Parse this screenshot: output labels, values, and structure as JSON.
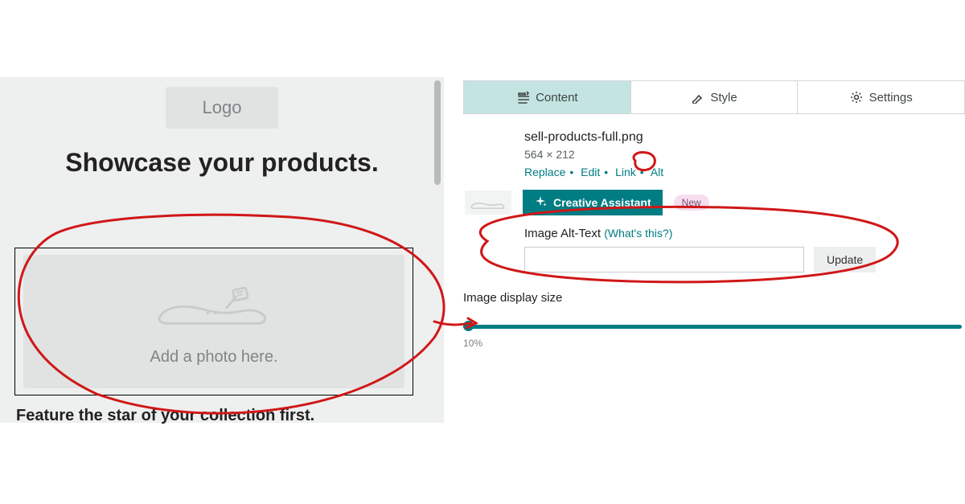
{
  "preview": {
    "logo_label": "Logo",
    "headline": "Showcase your products.",
    "placeholder_text": "Add a photo here.",
    "subheading": "Feature the star of your collection first."
  },
  "tabs": {
    "content": "Content",
    "style": "Style",
    "settings": "Settings"
  },
  "file": {
    "name": "sell-products-full.png",
    "dimensions": "564 × 212",
    "actions": {
      "replace": "Replace",
      "edit": "Edit",
      "link": "Link",
      "alt": "Alt"
    }
  },
  "creative_assistant": {
    "button": "Creative Assistant",
    "badge": "New"
  },
  "alt": {
    "label": "Image Alt-Text ",
    "whats_this": "(What's this?)",
    "value": "",
    "update": "Update"
  },
  "display_size": {
    "label": "Image display size",
    "percent": "10%"
  }
}
